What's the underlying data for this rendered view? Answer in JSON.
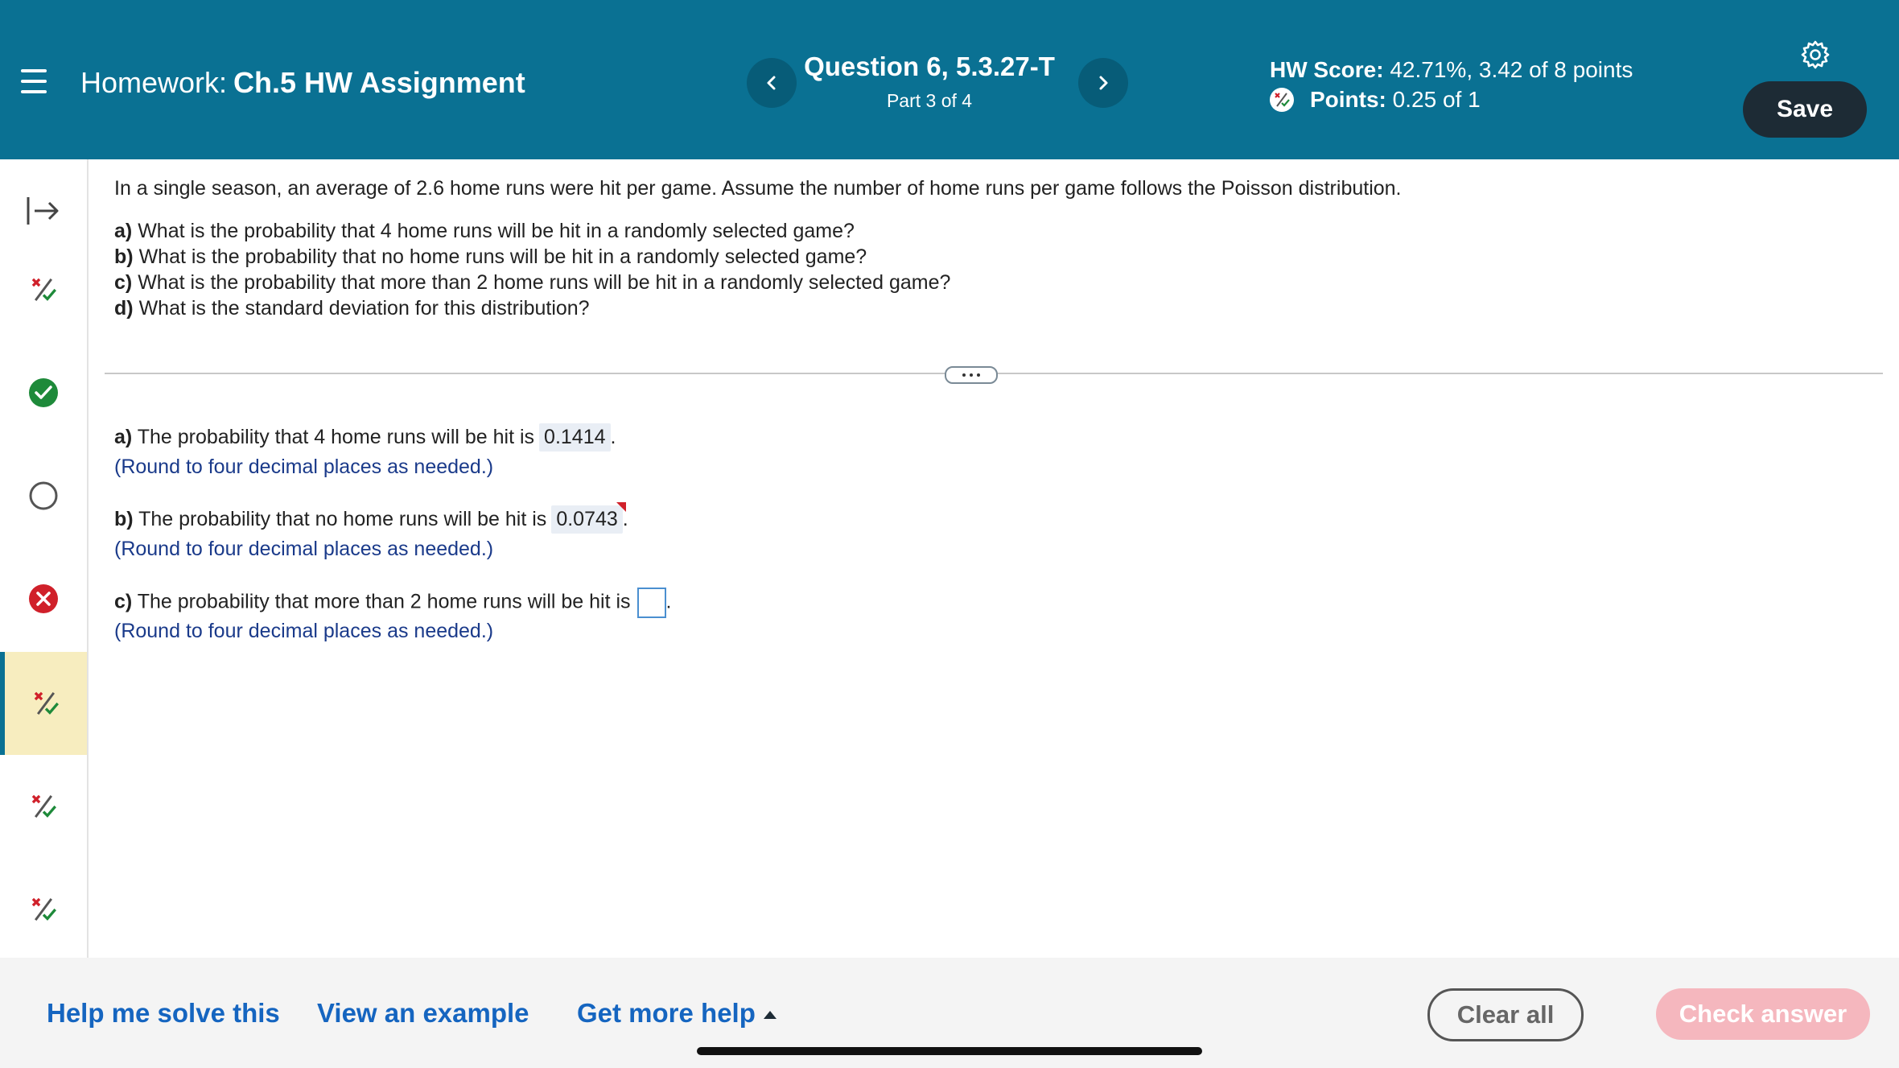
{
  "header": {
    "hw_prefix": "Homework:",
    "hw_name": "Ch.5 HW Assignment",
    "question_title": "Question 6, 5.3.27-T",
    "question_part": "Part 3 of 4",
    "hw_score_label": "HW Score:",
    "hw_score_value": "42.71%, 3.42 of 8 points",
    "points_label": "Points:",
    "points_value": "0.25 of 1",
    "save_label": "Save"
  },
  "sidebar": {
    "items": [
      {
        "icon": "expand-arrow-icon",
        "state": "expand"
      },
      {
        "icon": "partial-credit-icon",
        "state": "partial"
      },
      {
        "icon": "check-circle-icon",
        "state": "correct"
      },
      {
        "icon": "empty-circle-icon",
        "state": "unanswered"
      },
      {
        "icon": "x-circle-icon",
        "state": "incorrect"
      },
      {
        "icon": "partial-credit-icon",
        "state": "partial-active"
      },
      {
        "icon": "partial-credit-icon",
        "state": "partial"
      },
      {
        "icon": "partial-credit-icon",
        "state": "partial"
      }
    ]
  },
  "question": {
    "intro": "In a single season, an average of 2.6 home runs were hit per game. Assume the number of home runs per game follows the Poisson distribution.",
    "parts": [
      {
        "label": "a)",
        "text": "What is the probability that 4 home runs will be hit in a randomly selected game?"
      },
      {
        "label": "b)",
        "text": "What is the probability that no home runs will be hit in a randomly selected game?"
      },
      {
        "label": "c)",
        "text": "What is the probability that more than 2 home runs will be hit in a randomly selected game?"
      },
      {
        "label": "d)",
        "text": "What is the standard deviation for this distribution?"
      }
    ]
  },
  "answers": {
    "a": {
      "label": "a)",
      "text": "The probability that 4 home runs will be hit is",
      "value": "0.1414",
      "period": ".",
      "hint": "(Round to four decimal places as needed.)"
    },
    "b": {
      "label": "b)",
      "text": "The probability that no home runs will be hit is",
      "value": "0.0743",
      "period": ".",
      "hint": "(Round to four decimal places as needed.)"
    },
    "c": {
      "label": "c)",
      "text": "The probability that more than 2 home runs will be hit is",
      "value": "",
      "period": ".",
      "hint": "(Round to four decimal places as needed.)"
    }
  },
  "footer": {
    "help_solve": "Help me solve this",
    "view_example": "View an example",
    "more_help": "Get more help",
    "clear_all": "Clear all",
    "check_answer": "Check answer"
  },
  "colors": {
    "header_bg": "#0a7193",
    "save_bg": "#1d2b35",
    "link": "#1565c0",
    "hint": "#1a3a8a",
    "check_btn": "#f5b7be",
    "active_row": "#f7edbf",
    "correct": "#1e8a3a",
    "incorrect": "#d0202a"
  }
}
